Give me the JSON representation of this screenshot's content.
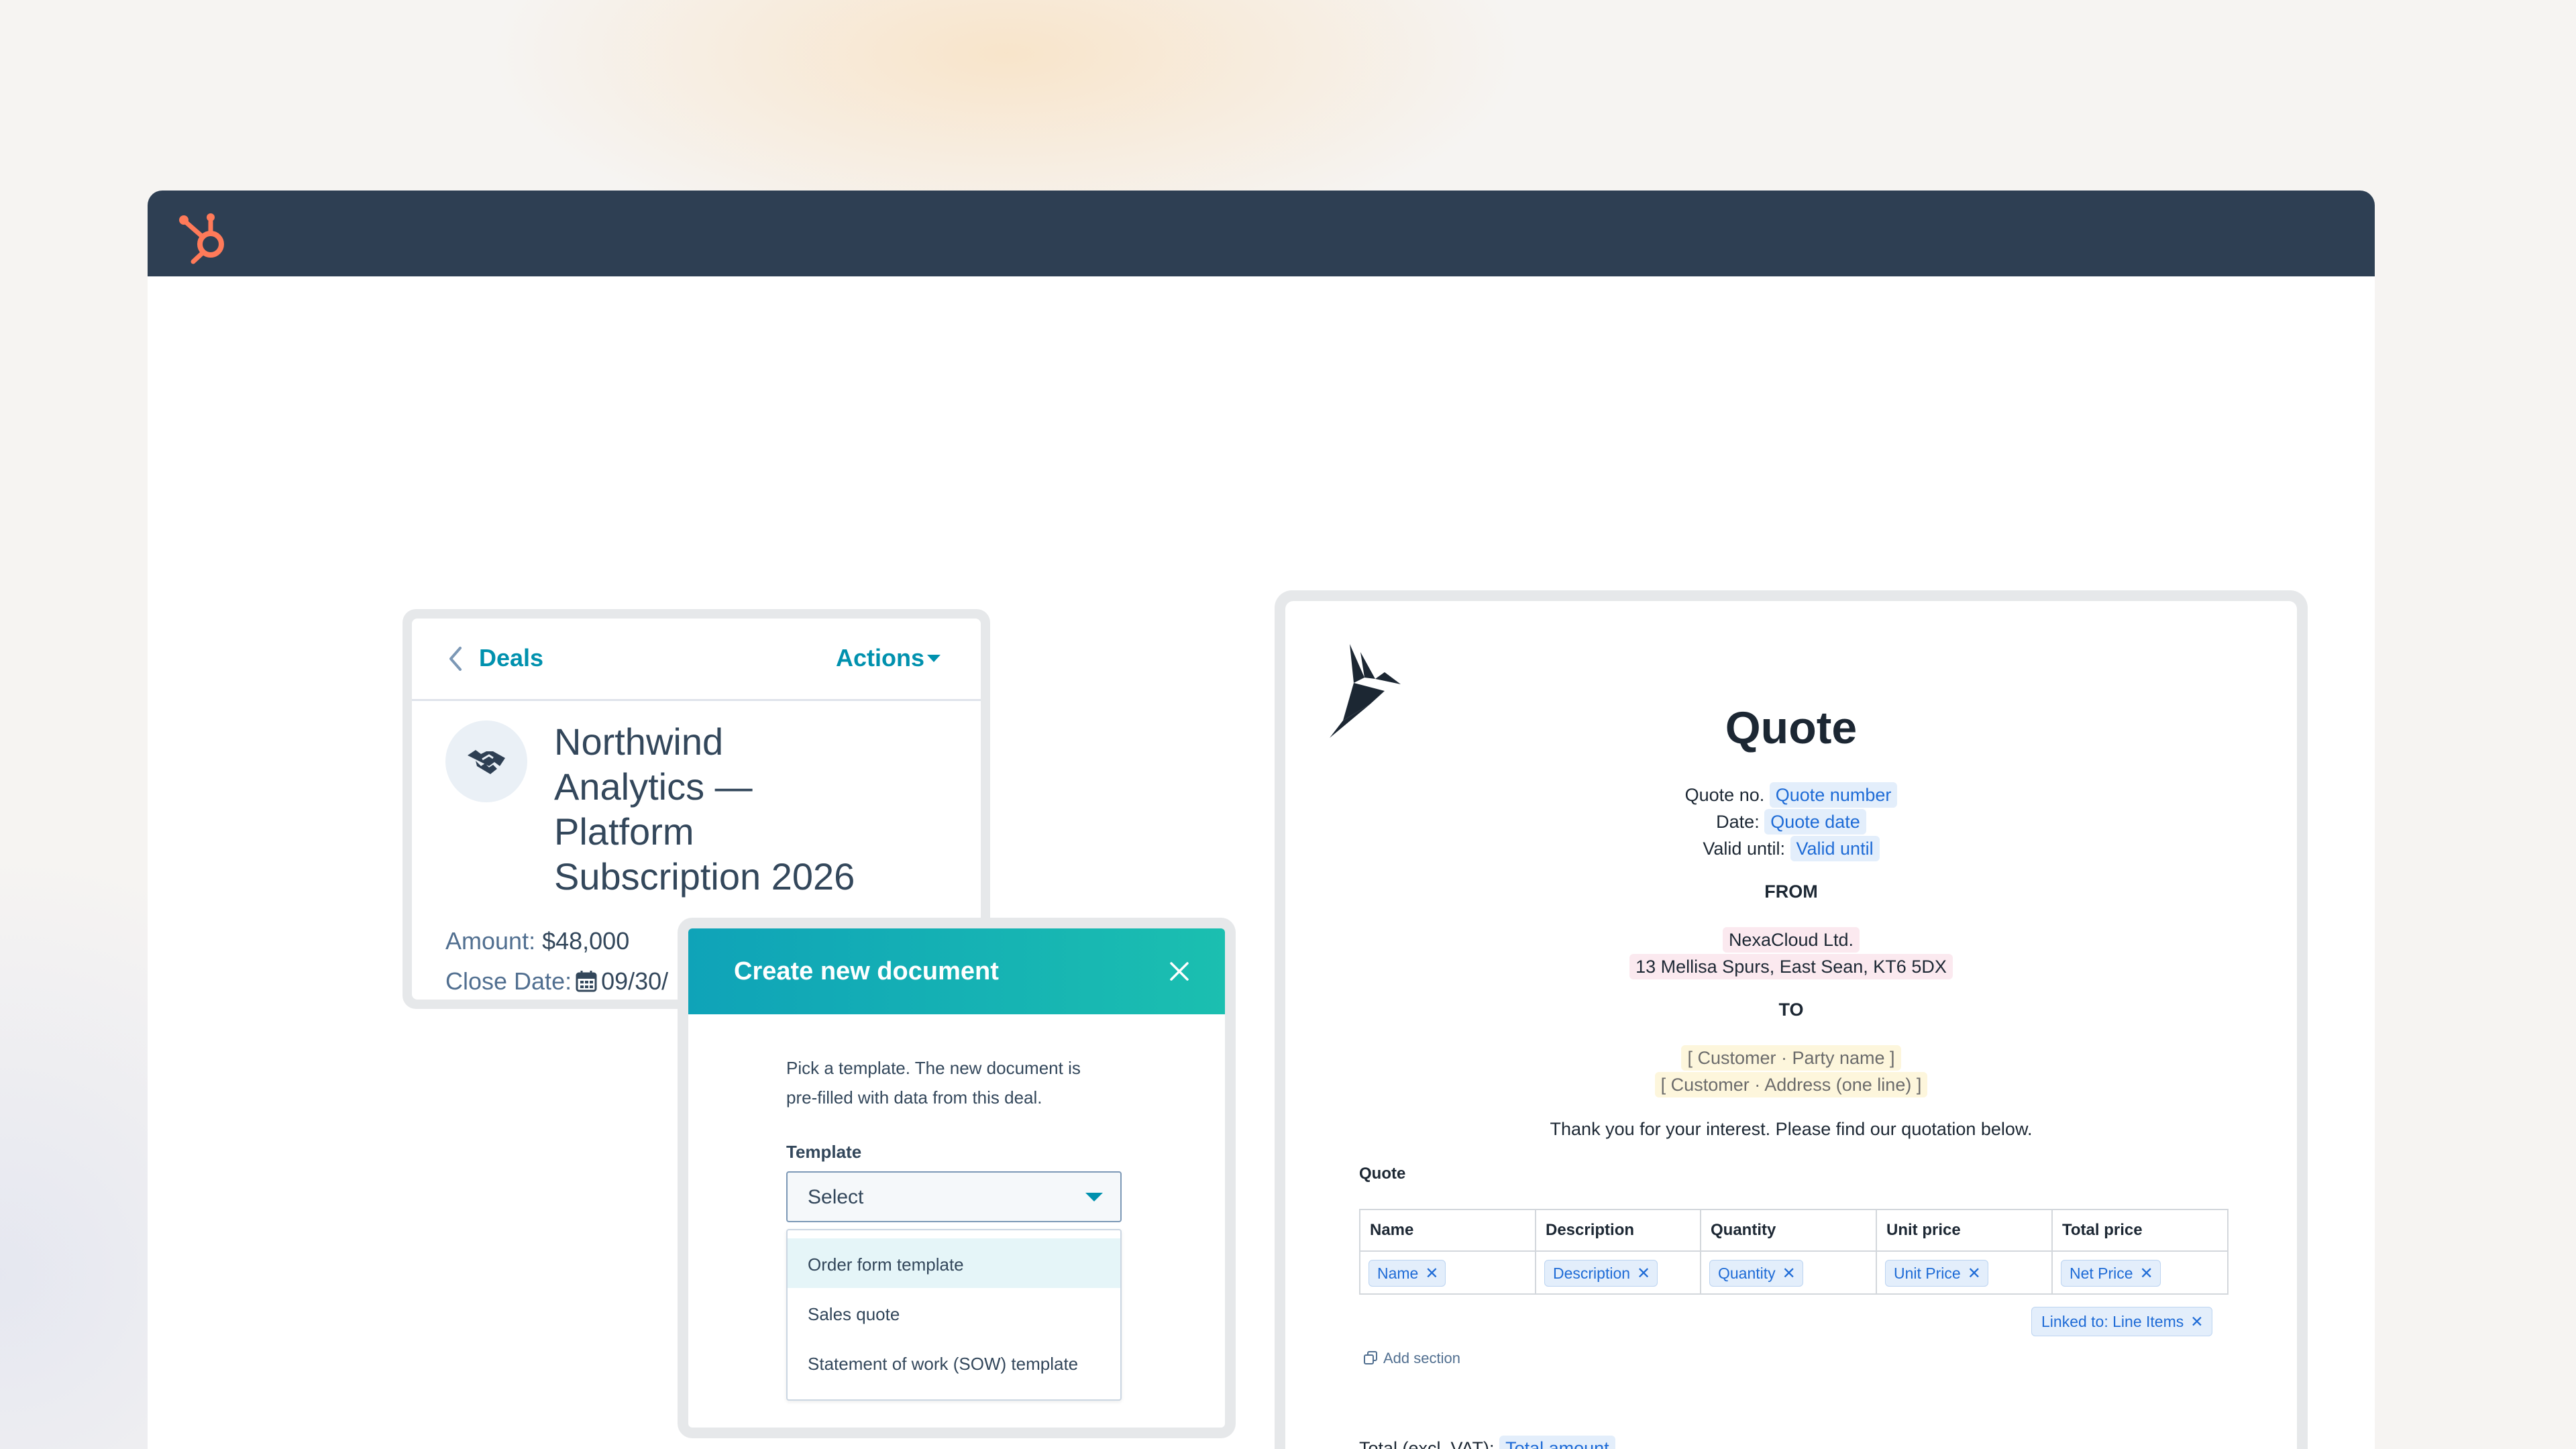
{
  "colors": {
    "topbar": "#2e3f53",
    "hubspot_orange": "#ff7a59",
    "link_teal": "#0091ae",
    "modal_gradient_start": "#0fa3b8",
    "modal_gradient_end": "#1bbfb0",
    "chip_blue": "#1e6bd6"
  },
  "icons": {
    "logo": "hubspot-sprocket-icon",
    "back": "chevron-left-icon",
    "deal": "handshake-icon",
    "calendar": "calendar-icon",
    "close": "close-icon",
    "caret": "caret-down-icon",
    "brand": "origami-bird-logo",
    "add_section": "copy-icon"
  },
  "deal_card": {
    "back_label": "Deals",
    "actions_label": "Actions",
    "title_lines": [
      "Northwind",
      "Analytics —",
      "Platform",
      "Subscription 2026"
    ],
    "amount_label": "Amount:",
    "amount_value": "$48,000",
    "close_date_label": "Close Date:",
    "close_date_value": "09/30/"
  },
  "modal": {
    "title": "Create new document",
    "description_lines": [
      "Pick a template. The new document is",
      "pre-filled with data from this deal."
    ],
    "template_label": "Template",
    "select_value": "Select",
    "options": [
      "Order form template",
      "Sales quote",
      "Statement of work (SOW) template"
    ],
    "highlighted_option_index": 0
  },
  "quote": {
    "title": "Quote",
    "quote_no_label": "Quote no.",
    "quote_no_chip": "Quote number",
    "date_label": "Date:",
    "date_chip": "Quote date",
    "valid_label": "Valid until:",
    "valid_chip": "Valid until",
    "from_heading": "FROM",
    "from_company": "NexaCloud Ltd.",
    "from_address": "13 Mellisa Spurs, East Sean, KT6 5DX",
    "to_heading": "TO",
    "to_party": "[ Customer · Party name ]",
    "to_address": "[ Customer · Address (one line) ]",
    "thank_you": "Thank you for your interest. Please find our quotation below.",
    "table_title": "Quote",
    "columns": [
      "Name",
      "Description",
      "Quantity",
      "Unit price",
      "Total price"
    ],
    "row_tags": [
      "Name",
      "Description",
      "Quantity",
      "Unit Price",
      "Net Price"
    ],
    "linked_tag": "Linked to: Line Items",
    "add_section": "Add section",
    "total_label": "Total (excl. VAT):",
    "total_chip": "Total amount"
  }
}
